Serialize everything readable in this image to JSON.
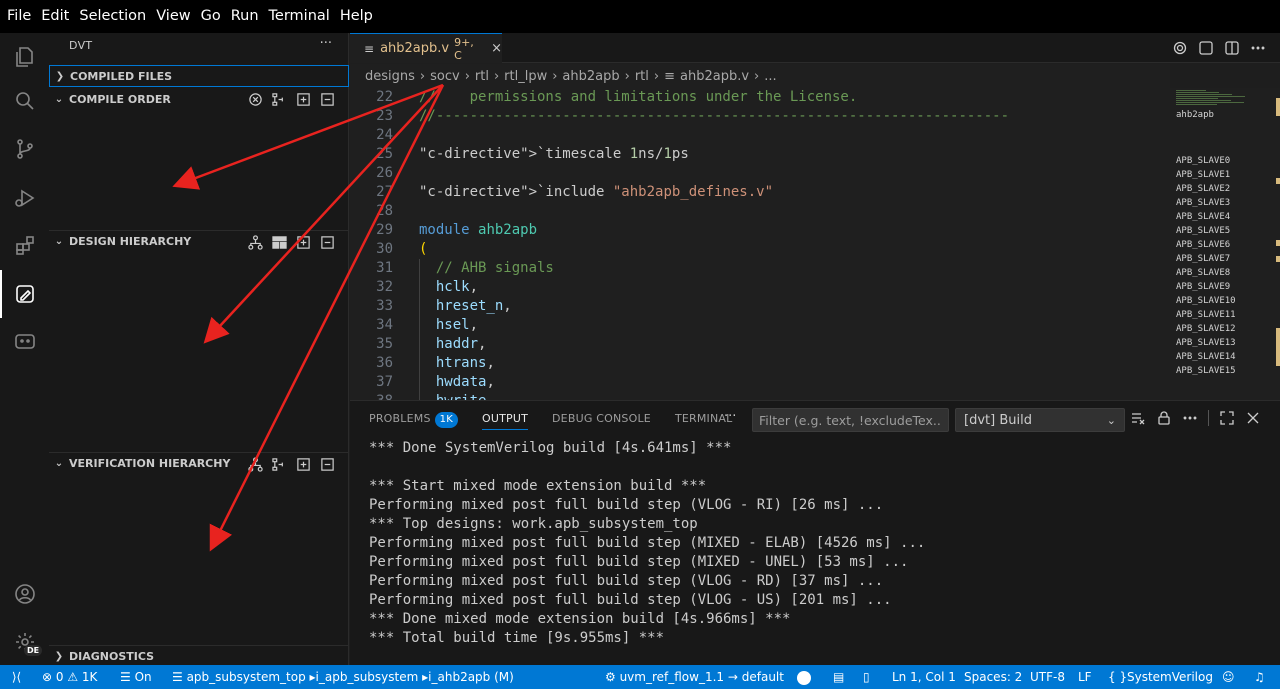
{
  "menu": [
    "File",
    "Edit",
    "Selection",
    "View",
    "Go",
    "Run",
    "Terminal",
    "Help"
  ],
  "activity": {
    "icons": [
      "explorer-icon",
      "search-icon",
      "source-control-icon",
      "run-debug-icon",
      "extensions-icon",
      "dvt-icon",
      "chat-icon",
      "account-icon",
      "settings-gear-icon"
    ],
    "settings_badge": "DE"
  },
  "sidebar": {
    "title": "DVT",
    "more": "···",
    "sections": [
      {
        "label": "COMPILED FILES",
        "state": "collapsed"
      },
      {
        "label": "COMPILE ORDER",
        "state": "expanded"
      },
      {
        "label": "DESIGN HIERARCHY",
        "state": "expanded"
      },
      {
        "label": "VERIFICATION HIERARCHY",
        "state": "expanded"
      },
      {
        "label": "DIAGNOSTICS",
        "state": "collapsed"
      }
    ]
  },
  "tab": {
    "name": "ahb2apb.v",
    "badge": "9+, C",
    "close": "×"
  },
  "breadcrumb": [
    "designs",
    "socv",
    "rtl",
    "rtl_lpw",
    "ahb2apb",
    "rtl",
    "ahb2apb.v",
    "..."
  ],
  "editor": {
    "lines": [
      {
        "n": "22",
        "text": "//    permissions and limitations under the License."
      },
      {
        "n": "23",
        "text": "//--------------------------------------------------------------------"
      },
      {
        "n": "24",
        "text": ""
      },
      {
        "n": "25",
        "text": "`timescale 1ns/1ps"
      },
      {
        "n": "26",
        "text": ""
      },
      {
        "n": "27",
        "text": "`include \"ahb2apb_defines.v\""
      },
      {
        "n": "28",
        "text": ""
      },
      {
        "n": "29",
        "text": "module ahb2apb"
      },
      {
        "n": "30",
        "text": "("
      },
      {
        "n": "31",
        "text": "  // AHB signals"
      },
      {
        "n": "32",
        "text": "  hclk,"
      },
      {
        "n": "33",
        "text": "  hreset_n,"
      },
      {
        "n": "34",
        "text": "  hsel,"
      },
      {
        "n": "35",
        "text": "  haddr,"
      },
      {
        "n": "36",
        "text": "  htrans,"
      },
      {
        "n": "37",
        "text": "  hwdata,"
      },
      {
        "n": "38",
        "text": "  hwrite,"
      }
    ]
  },
  "minimap": {
    "module_label": "ahb2apb",
    "slaves": [
      "APB_SLAVE0",
      "APB_SLAVE1",
      "APB_SLAVE2",
      "APB_SLAVE3",
      "APB_SLAVE4",
      "APB_SLAVE5",
      "APB_SLAVE6",
      "APB_SLAVE7",
      "APB_SLAVE8",
      "APB_SLAVE9",
      "APB_SLAVE10",
      "APB_SLAVE11",
      "APB_SLAVE12",
      "APB_SLAVE13",
      "APB_SLAVE14",
      "APB_SLAVE15"
    ]
  },
  "panel": {
    "tabs": [
      {
        "label": "PROBLEMS",
        "count": "1K"
      },
      {
        "label": "OUTPUT",
        "active": true
      },
      {
        "label": "DEBUG CONSOLE"
      },
      {
        "label": "TERMINAL"
      }
    ],
    "more": "···",
    "filter_placeholder": "Filter (e.g. text, !excludeTex...",
    "channel": "[dvt] Build",
    "output_lines": [
      "*** Done SystemVerilog build [4s.641ms] ***",
      "",
      "*** Start mixed mode extension build ***",
      "Performing mixed post full build step (VLOG - RI) [26 ms] ...",
      "*** Top designs: work.apb_subsystem_top",
      "Performing mixed post full build step (MIXED - ELAB) [4526 ms] ...",
      "Performing mixed post full build step (MIXED - UNEL) [53 ms] ...",
      "Performing mixed post full build step (VLOG - RD) [37 ms] ...",
      "Performing mixed post full build step (VLOG - US) [201 ms] ...",
      "*** Done mixed mode extension build [4s.966ms] ***",
      "*** Total build time [9s.955ms] ***"
    ]
  },
  "status": {
    "errors": "0",
    "warnings": "1K",
    "filter_state": "On",
    "hierarchy": [
      "apb_subsystem_top",
      "i_apb_subsystem",
      "i_ahb2apb (M)"
    ],
    "config": "uvm_ref_flow_1.1",
    "config_target": "default",
    "position": "Ln 1, Col 1",
    "spaces": "Spaces: 2",
    "encoding": "UTF-8",
    "eol": "LF",
    "braces": "{ }",
    "language": "SystemVerilog"
  },
  "colors": {
    "statusbar": "#0078d4",
    "annotation_arrow": "#e8231f",
    "accent": "#0078d4"
  }
}
